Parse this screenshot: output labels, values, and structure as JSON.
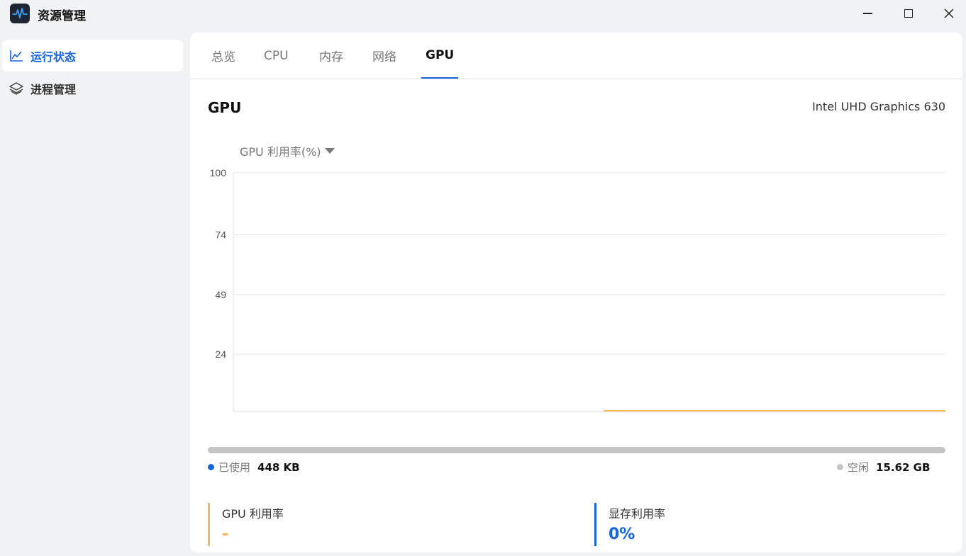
{
  "app": {
    "title": "资源管理"
  },
  "window": {
    "minimize_icon": "minimize-icon",
    "maximize_icon": "maximize-icon",
    "close_icon": "close-icon"
  },
  "sidebar": {
    "items": [
      {
        "label": "运行状态",
        "icon": "line-chart-icon",
        "active": true
      },
      {
        "label": "进程管理",
        "icon": "layers-icon",
        "active": false
      }
    ]
  },
  "tabs": [
    {
      "label": "总览",
      "active": false
    },
    {
      "label": "CPU",
      "active": false
    },
    {
      "label": "内存",
      "active": false
    },
    {
      "label": "网络",
      "active": false
    },
    {
      "label": "GPU",
      "active": true
    }
  ],
  "gpu": {
    "heading": "GPU",
    "model": "Intel UHD Graphics 630",
    "metric_select": "GPU 利用率(%)"
  },
  "chart_data": {
    "type": "line",
    "title": "",
    "ylabel": "GPU 利用率(%)",
    "ylim": [
      0,
      100
    ],
    "yticks": [
      "100",
      "74",
      "49",
      "24"
    ],
    "grid": true,
    "series": [
      {
        "values": [
          0,
          0,
          0,
          0,
          0,
          0,
          0,
          0,
          0,
          0,
          0,
          0
        ],
        "x_start_fraction_of_range": 0.52,
        "color": "#f5b759"
      }
    ]
  },
  "memory": {
    "used_label": "已使用",
    "used_value": "448 KB",
    "free_label": "空闲",
    "free_value": "15.62 GB",
    "used_color": "#1565e0",
    "free_color": "#c5c5c5"
  },
  "stats": {
    "gpu_util_label": "GPU 利用率",
    "gpu_util_value": "-",
    "gpu_util_color": "#f5b759",
    "vram_util_label": "显存利用率",
    "vram_util_value": "0%",
    "vram_util_color": "#1565e0"
  }
}
